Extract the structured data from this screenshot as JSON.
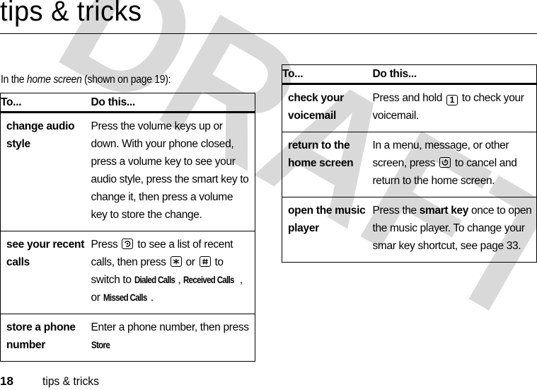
{
  "page": {
    "title": "tips & tricks",
    "watermark": "DRAFT",
    "watermark_color": "#d9d9d9",
    "intro": {
      "prefix": "In the ",
      "emphasis": "home screen",
      "suffix": " (shown on page 19):"
    },
    "footer": {
      "page_number": "18",
      "section_title": "tips & tricks"
    }
  },
  "left_table": {
    "headers": [
      "To...",
      "Do this..."
    ],
    "rows": [
      {
        "task": "change audio style",
        "instructions": "Press the volume keys up or down. With your phone closed, press a volume key to see your audio style, press the smart key to change it, then press a volume key to store the change."
      },
      {
        "task": "see your recent calls",
        "parts": {
          "t1": "Press ",
          "icon1": "send-key-icon",
          "t2": " to see a list of recent calls, then press ",
          "icon2": "star-key-icon",
          "t3": " or ",
          "icon3": "pound-key-icon",
          "t4": " to switch to ",
          "term1": "Dialed Calls",
          "t5": ", ",
          "term2": "Received Calls",
          "t6": ", or ",
          "term3": "Missed Calls",
          "t7": "."
        }
      },
      {
        "task": "store a phone number",
        "parts": {
          "t1": "Enter a phone number, then press ",
          "term1": "Store",
          "t2": "."
        }
      }
    ]
  },
  "right_table": {
    "headers": [
      "To...",
      "Do this..."
    ],
    "rows": [
      {
        "task": "check your voicemail",
        "parts": {
          "t1": "Press and hold ",
          "icon1": "one-key-icon",
          "icon1_label": "1",
          "t2": " to check your voicemail."
        }
      },
      {
        "task": "return to the home screen",
        "parts": {
          "t1": "In a menu, message, or other screen, press ",
          "icon1": "end-key-icon",
          "t2": " to cancel and return to the home screen."
        }
      },
      {
        "task": "open the music player",
        "parts": {
          "t1": "Press the ",
          "strong1": "smart key",
          "t2": " once to open the music player. To change your smar key shortcut, see page 33."
        }
      }
    ]
  }
}
